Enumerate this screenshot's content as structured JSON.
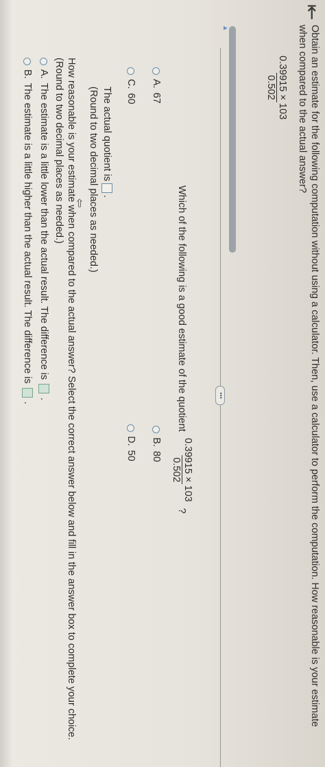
{
  "nav": {
    "back_icon": "back-arrow-icon",
    "back_glyph": "⇤"
  },
  "prompt": {
    "text": "Obtain an estimate for the following computation without using a calculator. Then, use a calculator to perform the computation. How reasonable is your estimate when compared to the actual answer?",
    "fraction_numerator": "0.39915 × 103",
    "fraction_denominator": "0.502"
  },
  "more_button": {
    "label": "•••"
  },
  "question1": {
    "text": "Which of the following is a good estimate of the quotient",
    "fraction_numerator": "0.39915 × 103",
    "fraction_denominator": "0.502",
    "suffix": "?",
    "options": [
      {
        "letter": "A.",
        "value": "67"
      },
      {
        "letter": "B.",
        "value": "80"
      },
      {
        "letter": "C.",
        "value": "60"
      },
      {
        "letter": "D.",
        "value": "50"
      }
    ]
  },
  "actual": {
    "label": "The actual quotient is",
    "suffix": ".",
    "round_note": "(Round to two decimal places as needed.)"
  },
  "question2": {
    "text": "How reasonable is your estimate when compared to the actual answer? Select the correct answer below and fill in the answer box to complete your choice.",
    "round_note": "(Round to two decimal places as needed.)",
    "options": [
      {
        "letter": "A.",
        "text": "The estimate is a little lower than the actual result. The difference is",
        "suffix": "."
      },
      {
        "letter": "B.",
        "text": "The estimate is a little higher than the actual result. The difference is",
        "suffix": "."
      }
    ]
  },
  "colors": {
    "radio_border": "#6a8ea8",
    "filled_box": "#cfe3d6",
    "accent_arrow": "#6f8fc4"
  }
}
